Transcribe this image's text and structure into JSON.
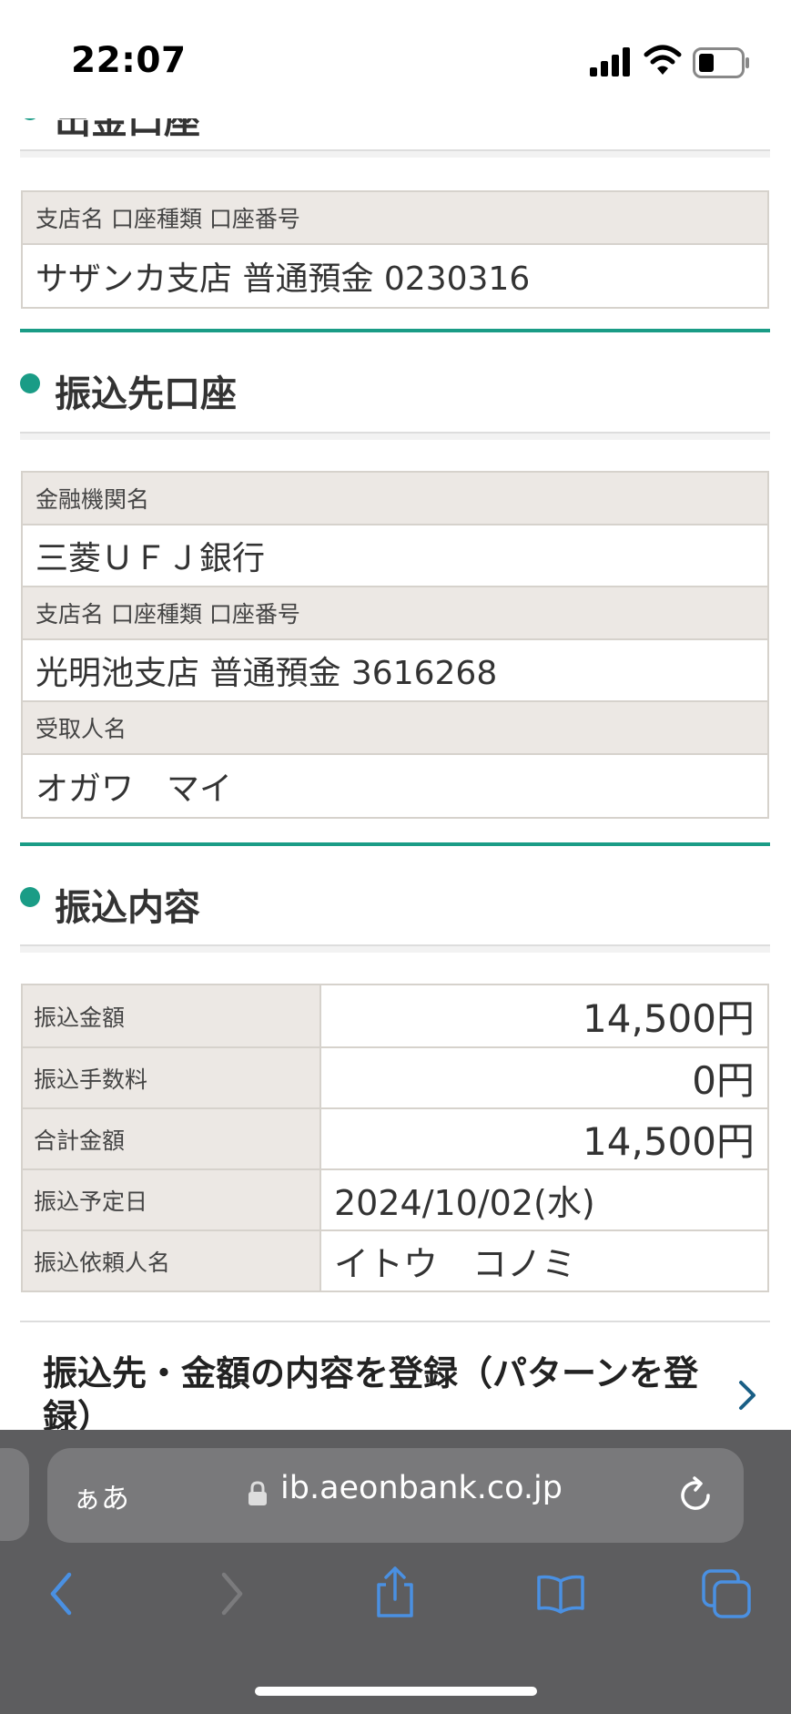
{
  "status_bar": {
    "time": "22:07"
  },
  "sections": {
    "withdrawal": {
      "partial_title": "出金口座",
      "label": "支店名 口座種類 口座番号",
      "value": "サザンカ支店 普通預金 0230316"
    },
    "destination": {
      "title": "振込先口座",
      "bank_label": "金融機関名",
      "bank_value": "三菱ＵＦＪ銀行",
      "branch_label": "支店名 口座種類 口座番号",
      "branch_value": "光明池支店 普通預金 3616268",
      "recipient_label": "受取人名",
      "recipient_value": "オガワ　マイ"
    },
    "transfer": {
      "title": "振込内容",
      "rows": [
        {
          "label": "振込金額",
          "value": "14,500円"
        },
        {
          "label": "振込手数料",
          "value": "0円"
        },
        {
          "label": "合計金額",
          "value": "14,500円"
        },
        {
          "label": "振込予定日",
          "value": "2024/10/02(水)"
        },
        {
          "label": "振込依頼人名",
          "value": "イトウ　コノミ"
        }
      ]
    }
  },
  "register_link": {
    "label": "振込先・金額の内容を登録（パターンを登録）"
  },
  "browser": {
    "aa_label": "ぁあ",
    "url": "ib.aeonbank.co.jp"
  },
  "colors": {
    "accent": "#1a9c86",
    "label_bg": "#ece8e4",
    "browser_bar": "#5d5d5f",
    "toolbar_icon": "#4a90e2"
  },
  "icons": [
    "signal-icon",
    "wifi-icon",
    "battery-icon",
    "chevron-right-icon",
    "lock-icon",
    "reload-icon",
    "back-icon",
    "forward-icon",
    "share-icon",
    "bookmarks-icon",
    "tabs-icon"
  ]
}
